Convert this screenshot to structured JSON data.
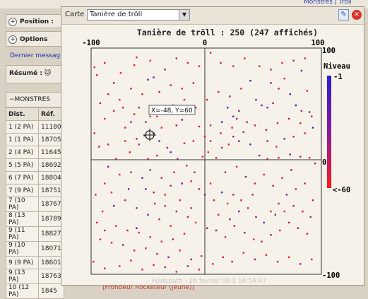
{
  "background": {
    "top_link": "Monstres | Trôll",
    "position_label": "Position :",
    "options_label": "Options",
    "last_message": "Dernier messag",
    "resume_label": "Résumé :",
    "resume_icon": "cat-face-icon",
    "monsters_header": "MONSTRES",
    "table_headers": [
      "Dist.",
      "Réf."
    ],
    "table_rows": [
      [
        "1 (2 PA)",
        "11180"
      ],
      [
        "1 (1 PA)",
        "18705"
      ],
      [
        "2 (4 PA)",
        "11645"
      ],
      [
        "5 (5 PA)",
        "18692"
      ],
      [
        "6 (7 PA)",
        "18804"
      ],
      [
        "7 (9 PA)",
        "18751"
      ],
      [
        "7 (10 PA)",
        "18767"
      ],
      [
        "8 (13 PA)",
        "18789"
      ],
      [
        "9 (11 PA)",
        "18827"
      ],
      [
        "9 (10 PA)",
        "18071"
      ],
      [
        "9 (9 PA)",
        "18601"
      ],
      [
        "9 (13 PA)",
        "18763"
      ],
      [
        "10 (12 PA)",
        "1845"
      ]
    ],
    "bottom_link": "[Frondeur Rocketeur (Jeune)]"
  },
  "popup": {
    "carte_label": "Carte :",
    "carte_value": "Tanière de trõll",
    "tool_icon": "edit-icon",
    "close_icon": "close-icon",
    "watermark": "Feldspath - 26 fevrier 08 à 16:54:47",
    "tooltip": "X=-48, Y=60"
  },
  "chart_data": {
    "type": "scatter",
    "title": "Tanière de trõll : 250 (247 affichés)",
    "xlim": [
      -100,
      100
    ],
    "ylim": [
      -100,
      100
    ],
    "xticks": [
      "-100",
      "0",
      "100"
    ],
    "yticks": [
      "100",
      "0",
      "-100"
    ],
    "legend": {
      "title": "Niveau",
      "top": "-1",
      "bottom": "<-60",
      "colors": [
        "#2a1cd6",
        "#ff1a1a"
      ]
    },
    "points": [
      [
        5,
        97,
        30
      ],
      [
        -60,
        93,
        40
      ],
      [
        14,
        88,
        35
      ],
      [
        -35,
        82,
        20
      ],
      [
        -74,
        79,
        50
      ],
      [
        -95,
        77,
        42
      ],
      [
        -45,
        75,
        15
      ],
      [
        -50,
        73,
        10
      ],
      [
        -80,
        70,
        30
      ],
      [
        40,
        72,
        5
      ],
      [
        58,
        70,
        25
      ],
      [
        70,
        74,
        40
      ],
      [
        85,
        81,
        8
      ],
      [
        65,
        65,
        35
      ],
      [
        75,
        60,
        15
      ],
      [
        90,
        63,
        45
      ],
      [
        45,
        55,
        20
      ],
      [
        50,
        50,
        10
      ],
      [
        55,
        48,
        12
      ],
      [
        60,
        52,
        30
      ],
      [
        80,
        50,
        8
      ],
      [
        85,
        45,
        35
      ],
      [
        92,
        44,
        18
      ],
      [
        30,
        45,
        25
      ],
      [
        25,
        40,
        10
      ],
      [
        28,
        38,
        22
      ],
      [
        20,
        48,
        6
      ],
      [
        37,
        35,
        30
      ],
      [
        15,
        35,
        8
      ],
      [
        5,
        32,
        35
      ],
      [
        -5,
        31,
        40
      ],
      [
        -20,
        37,
        18
      ],
      [
        -25,
        32,
        25
      ],
      [
        -38,
        30,
        42
      ],
      [
        -45,
        25,
        8
      ],
      [
        -53,
        23,
        35
      ],
      [
        -60,
        20,
        30
      ],
      [
        -70,
        18,
        48
      ],
      [
        -85,
        15,
        38
      ],
      [
        -93,
        13,
        28
      ],
      [
        -97,
        25,
        36
      ],
      [
        -75,
        55,
        47
      ],
      [
        -80,
        45,
        44
      ],
      [
        -65,
        35,
        22
      ],
      [
        -40,
        18,
        10
      ],
      [
        -33,
        12,
        28
      ],
      [
        -30,
        8,
        15
      ],
      [
        -42,
        5,
        36
      ],
      [
        -50,
        2,
        42
      ],
      [
        -24,
        2,
        26
      ],
      [
        -18,
        16,
        33
      ],
      [
        -10,
        18,
        45
      ],
      [
        0,
        22,
        48
      ],
      [
        5,
        18,
        38
      ],
      [
        3,
        8,
        50
      ],
      [
        -2,
        4,
        55
      ],
      [
        10,
        3,
        40
      ],
      [
        15,
        12,
        35
      ],
      [
        21,
        15,
        45
      ],
      [
        25,
        22,
        30
      ],
      [
        30,
        18,
        25
      ],
      [
        40,
        15,
        10
      ],
      [
        55,
        18,
        28
      ],
      [
        63,
        13,
        45
      ],
      [
        70,
        20,
        15
      ],
      [
        78,
        22,
        35
      ],
      [
        88,
        25,
        40
      ],
      [
        95,
        30,
        12
      ],
      [
        48,
        5,
        25
      ],
      [
        55,
        2,
        38
      ],
      [
        65,
        3,
        45
      ],
      [
        75,
        6,
        20
      ],
      [
        84,
        4,
        33
      ],
      [
        92,
        3,
        45
      ],
      [
        97,
        -2,
        38
      ],
      [
        -85,
        -5,
        20
      ],
      [
        -75,
        -12,
        40
      ],
      [
        -65,
        -10,
        32
      ],
      [
        -55,
        -15,
        18
      ],
      [
        -52,
        -25,
        8
      ],
      [
        -45,
        -28,
        35
      ],
      [
        -35,
        -30,
        45
      ],
      [
        -30,
        -22,
        28
      ],
      [
        -20,
        -20,
        15
      ],
      [
        -12,
        -18,
        42
      ],
      [
        -5,
        -25,
        30
      ],
      [
        0,
        -30,
        22
      ],
      [
        5,
        -20,
        48
      ],
      [
        8,
        -35,
        35
      ],
      [
        15,
        -28,
        5
      ],
      [
        20,
        -38,
        42
      ],
      [
        25,
        -30,
        30
      ],
      [
        30,
        -45,
        20
      ],
      [
        38,
        -42,
        36
      ],
      [
        45,
        -50,
        25
      ],
      [
        52,
        -55,
        12
      ],
      [
        58,
        -45,
        44
      ],
      [
        65,
        -38,
        35
      ],
      [
        72,
        -30,
        18
      ],
      [
        80,
        -25,
        42
      ],
      [
        88,
        -20,
        30
      ],
      [
        95,
        -35,
        38
      ],
      [
        -95,
        -55,
        45
      ],
      [
        -90,
        -45,
        40
      ],
      [
        -80,
        -40,
        15
      ],
      [
        -70,
        -35,
        38
      ],
      [
        -60,
        -42,
        25
      ],
      [
        -50,
        -48,
        10
      ],
      [
        -40,
        -52,
        35
      ],
      [
        -30,
        -58,
        42
      ],
      [
        -25,
        -45,
        22
      ],
      [
        -15,
        -50,
        38
      ],
      [
        -8,
        -55,
        48
      ],
      [
        2,
        -60,
        30
      ],
      [
        10,
        -62,
        20
      ],
      [
        18,
        -68,
        40
      ],
      [
        26,
        -58,
        35
      ],
      [
        35,
        -64,
        18
      ],
      [
        43,
        -70,
        42
      ],
      [
        50,
        -72,
        30
      ],
      [
        58,
        -66,
        25
      ],
      [
        66,
        -62,
        45
      ],
      [
        74,
        -55,
        38
      ],
      [
        82,
        -60,
        28
      ],
      [
        90,
        -65,
        40
      ],
      [
        -92,
        -70,
        38
      ],
      [
        -82,
        -73,
        44
      ],
      [
        -72,
        -75,
        28
      ],
      [
        -62,
        -80,
        36
      ],
      [
        -52,
        -78,
        48
      ],
      [
        -42,
        -83,
        40
      ],
      [
        -32,
        -86,
        20
      ],
      [
        -22,
        -80,
        45
      ],
      [
        -12,
        -88,
        30
      ],
      [
        -3,
        -85,
        35
      ],
      [
        7,
        -92,
        48
      ],
      [
        16,
        -86,
        42
      ],
      [
        24,
        -90,
        30
      ],
      [
        34,
        -82,
        45
      ],
      [
        44,
        -88,
        25
      ],
      [
        54,
        -84,
        40
      ],
      [
        64,
        -90,
        36
      ],
      [
        74,
        -86,
        48
      ],
      [
        84,
        -92,
        28
      ],
      [
        94,
        -88,
        40
      ],
      [
        -98,
        -90,
        45
      ],
      [
        -88,
        -96,
        36
      ],
      [
        -75,
        -94,
        42
      ],
      [
        -65,
        -89,
        50
      ],
      [
        -55,
        -97,
        38
      ],
      [
        -45,
        -93,
        44
      ],
      [
        -35,
        -95,
        30
      ],
      [
        -25,
        -99,
        36
      ],
      [
        -15,
        -94,
        25
      ],
      [
        -5,
        -97,
        40
      ],
      [
        -60,
        -60,
        8
      ],
      [
        -67,
        -25,
        14
      ],
      [
        -48,
        -8,
        22
      ],
      [
        -38,
        -15,
        42
      ],
      [
        -27,
        -10,
        36
      ],
      [
        -16,
        -4,
        40
      ],
      [
        -9,
        -10,
        28
      ],
      [
        18,
        -10,
        34
      ],
      [
        28,
        -5,
        45
      ],
      [
        36,
        -14,
        22
      ],
      [
        44,
        -20,
        36
      ],
      [
        52,
        -12,
        44
      ],
      [
        60,
        -22,
        30
      ],
      [
        68,
        -15,
        40
      ],
      [
        76,
        -8,
        26
      ],
      [
        -88,
        38,
        46
      ],
      [
        -70,
        30,
        36
      ],
      [
        -58,
        48,
        25
      ],
      [
        -48,
        40,
        40
      ],
      [
        -38,
        45,
        30
      ],
      [
        -28,
        50,
        38
      ],
      [
        -18,
        55,
        44
      ],
      [
        -8,
        48,
        35
      ],
      [
        2,
        55,
        48
      ],
      [
        12,
        62,
        38
      ],
      [
        22,
        58,
        28
      ],
      [
        32,
        65,
        44
      ],
      [
        -10,
        70,
        30
      ],
      [
        -20,
        65,
        45
      ],
      [
        -30,
        68,
        36
      ],
      [
        -40,
        62,
        22
      ],
      [
        -55,
        60,
        42
      ],
      [
        -65,
        65,
        30
      ],
      [
        -85,
        60,
        44
      ],
      [
        -92,
        52,
        36
      ],
      [
        48,
        85,
        44
      ],
      [
        58,
        82,
        30
      ],
      [
        68,
        88,
        42
      ],
      [
        78,
        90,
        26
      ],
      [
        88,
        92,
        36
      ],
      [
        -15,
        88,
        42
      ],
      [
        -25,
        92,
        30
      ],
      [
        -48,
        90,
        40
      ],
      [
        -62,
        86,
        46
      ],
      [
        -88,
        88,
        32
      ],
      [
        -97,
        84,
        42
      ],
      [
        35,
        92,
        44
      ],
      [
        25,
        85,
        36
      ],
      [
        -5,
        85,
        46
      ],
      [
        -58,
        15,
        32
      ],
      [
        -66,
        8,
        44
      ],
      [
        -78,
        2,
        36
      ],
      [
        -88,
        -20,
        42
      ],
      [
        -96,
        -30,
        36
      ],
      [
        -82,
        -28,
        46
      ],
      [
        -35,
        -40,
        30
      ],
      [
        -44,
        -38,
        40
      ],
      [
        -22,
        -35,
        44
      ],
      [
        -12,
        -42,
        36
      ],
      [
        12,
        -48,
        42
      ],
      [
        22,
        -52,
        30
      ],
      [
        32,
        -35,
        44
      ],
      [
        42,
        -30,
        36
      ],
      [
        62,
        -48,
        28
      ],
      [
        70,
        -45,
        42
      ],
      [
        78,
        -40,
        34
      ],
      [
        86,
        -45,
        44
      ],
      [
        93,
        -50,
        30
      ],
      [
        -72,
        48,
        38
      ],
      [
        -62,
        42,
        46
      ],
      [
        -52,
        35,
        30
      ],
      [
        -42,
        40,
        44
      ],
      [
        14,
        25,
        36
      ],
      [
        24,
        30,
        44
      ],
      [
        34,
        26,
        28
      ],
      [
        44,
        32,
        40
      ],
      [
        54,
        28,
        34
      ],
      [
        64,
        34,
        46
      ],
      [
        74,
        38,
        30
      ],
      [
        84,
        34,
        42
      ],
      [
        94,
        40,
        36
      ],
      [
        -18,
        -65,
        44
      ],
      [
        -28,
        -70,
        30
      ],
      [
        -38,
        -72,
        42
      ],
      [
        -48,
        -68,
        34
      ],
      [
        -58,
        -64,
        46
      ],
      [
        -68,
        -62,
        30
      ],
      [
        -78,
        -58,
        40
      ],
      [
        -88,
        -62,
        36
      ]
    ]
  }
}
